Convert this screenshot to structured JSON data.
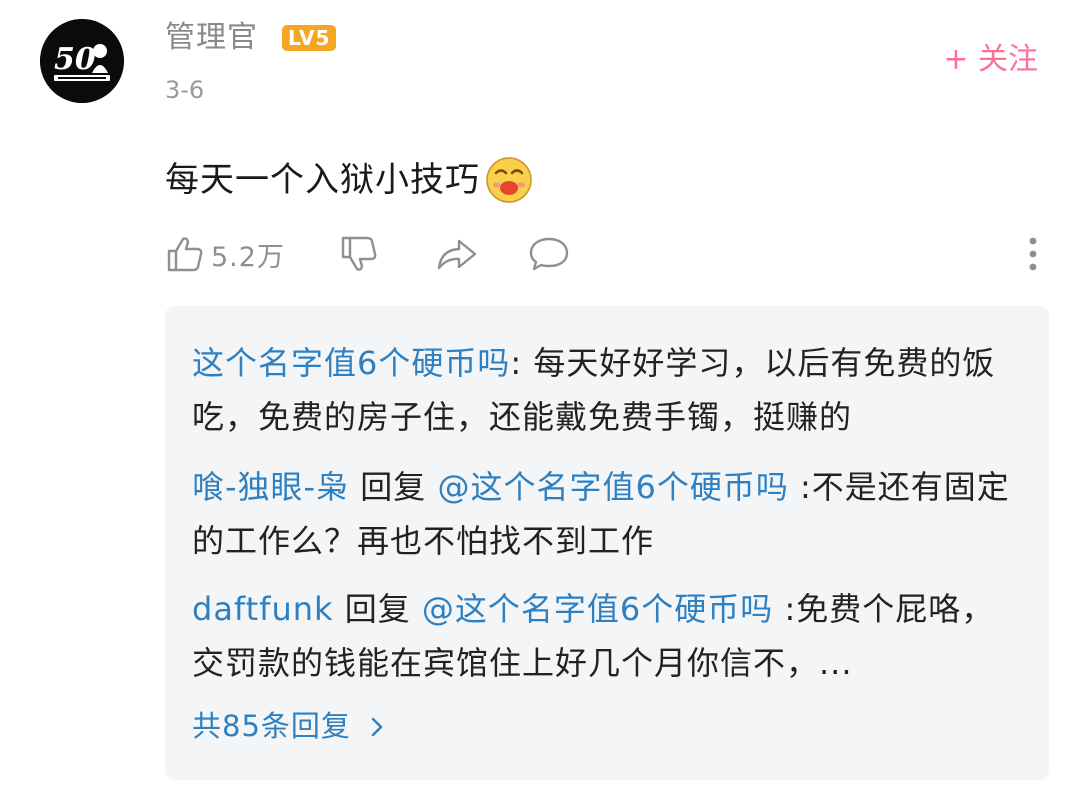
{
  "post": {
    "author": "管理官",
    "level_badge": "LV5",
    "date": "3-6",
    "follow_label": "+ 关注",
    "text": "每天一个入狱小技巧",
    "emoji": "laughing-face-emoji",
    "like_count": "5.2万"
  },
  "icons": {
    "like": "thumbs-up-icon",
    "dislike": "thumbs-down-icon",
    "share": "share-arrow-icon",
    "comment": "comment-bubble-icon",
    "more": "more-vertical-icon"
  },
  "replies": [
    {
      "name": "这个名字值6个硬币吗",
      "separator": ": ",
      "text": "每天好好学习，以后有免费的饭吃，免费的房子住，还能戴免费手镯，挺赚的"
    },
    {
      "name": "喰-独眼-枭",
      "reply_word": " 回复 ",
      "at": "@这个名字值6个硬币吗",
      "separator": " :",
      "text": "不是还有固定的工作么？再也不怕找不到工作"
    },
    {
      "name": "daftfunk",
      "reply_word": " 回复 ",
      "at": "@这个名字值6个硬币吗",
      "separator": " :",
      "text": "免费个屁咯，交罚款的钱能在宾馆住上好几个月你信不，..."
    }
  ],
  "total_replies_label": "共85条回复",
  "colors": {
    "link_blue": "#2f80c0",
    "follow_pink": "#fb7299",
    "badge_orange": "#f5a623",
    "reply_bg": "#f4f5f7"
  }
}
